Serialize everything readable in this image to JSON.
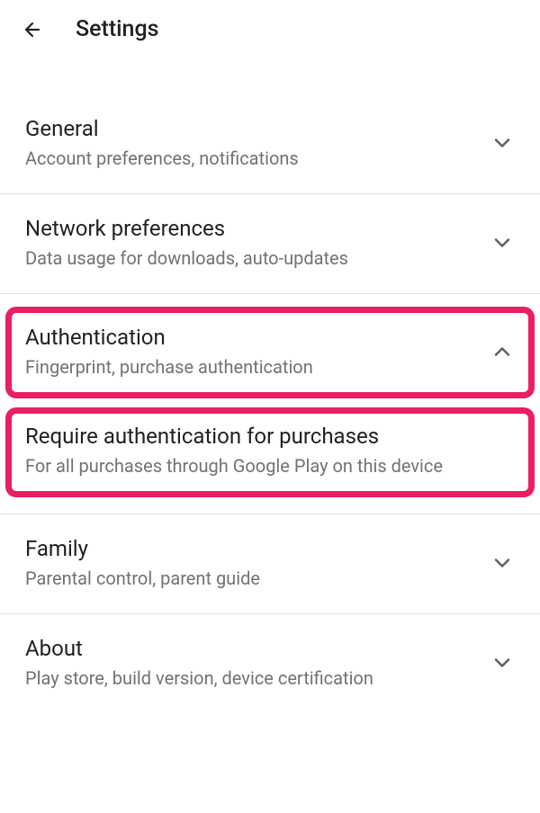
{
  "header": {
    "title": "Settings"
  },
  "sections": {
    "general": {
      "title": "General",
      "subtitle": "Account preferences, notifications"
    },
    "network": {
      "title": "Network preferences",
      "subtitle": "Data usage for downloads, auto-updates"
    },
    "authentication": {
      "title": "Authentication",
      "subtitle": "Fingerprint, purchase authentication"
    },
    "require_auth": {
      "title": "Require authentication for purchases",
      "subtitle": "For all purchases through Google Play on this device"
    },
    "family": {
      "title": "Family",
      "subtitle": "Parental control, parent guide"
    },
    "about": {
      "title": "About",
      "subtitle": "Play store, build version, device certification"
    }
  }
}
